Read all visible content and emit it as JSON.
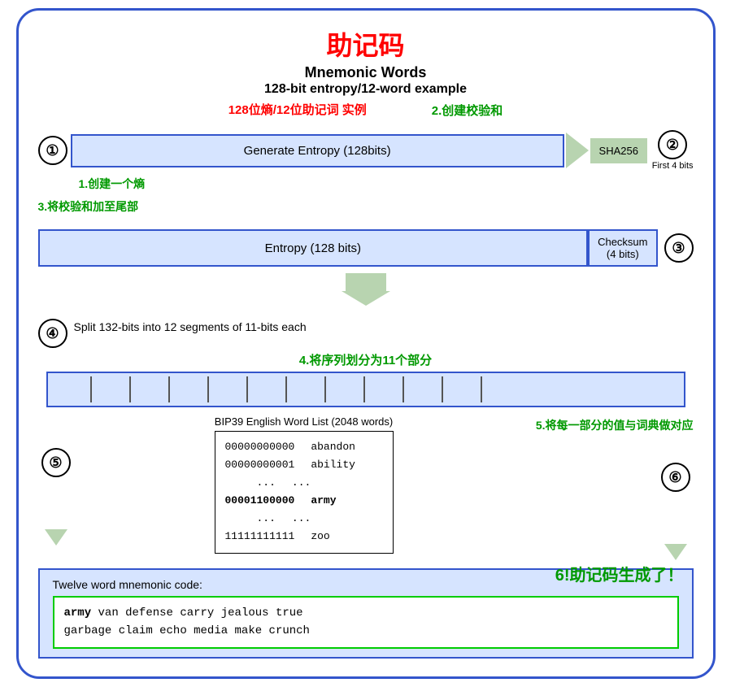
{
  "title": {
    "zh": "助记码",
    "en_title": "Mnemonic Words",
    "en_subtitle": "128-bit entropy/12-word example",
    "zh_subtitle": "128位熵/12位助记词 实例"
  },
  "annotations": {
    "a1": "1.创建一个熵",
    "a2": "2.创建校验和",
    "a3": "3.将校验和加至尾部",
    "a4": "4.将序列划分为11个部分",
    "a5": "5.将每一部分的值与词典做对应",
    "a6": "6!助记码生成了！"
  },
  "steps": {
    "s1": "①",
    "s2": "②",
    "s3": "③",
    "s4": "④",
    "s5": "⑤",
    "s6": "⑥"
  },
  "boxes": {
    "entropy_gen": "Generate Entropy (128bits)",
    "sha256": "SHA256",
    "first4bits": "First 4 bits",
    "entropy128": "Entropy (128 bits)",
    "checksum": "Checksum\n(4 bits)",
    "split_text": "Split 132-bits into 12 segments of 11-bits each",
    "bip39_title": "BIP39 English Word List (2048 words)",
    "mnemonic_label": "Twelve word mnemonic code:"
  },
  "bip39_table": {
    "rows": [
      {
        "bits": "00000000000",
        "word": "abandon",
        "bold": false
      },
      {
        "bits": "00000000001",
        "word": "ability",
        "bold": false
      },
      {
        "bits": "...",
        "word": "...",
        "bold": false
      },
      {
        "bits": "00001100000",
        "word": "army",
        "bold": true
      },
      {
        "bits": "...",
        "word": "...",
        "bold": false
      },
      {
        "bits": "11111111111",
        "word": "zoo",
        "bold": false
      }
    ]
  },
  "mnemonic": {
    "bold_word": "army",
    "rest": " van defense carry jealous true\ngarbage claim echo media make crunch"
  },
  "colors": {
    "blue_border": "#3355cc",
    "blue_bg": "#d6e4ff",
    "green_bg": "#b8d4b0",
    "red": "#ff0000",
    "green_text": "#009900",
    "green_border": "#00cc00"
  }
}
